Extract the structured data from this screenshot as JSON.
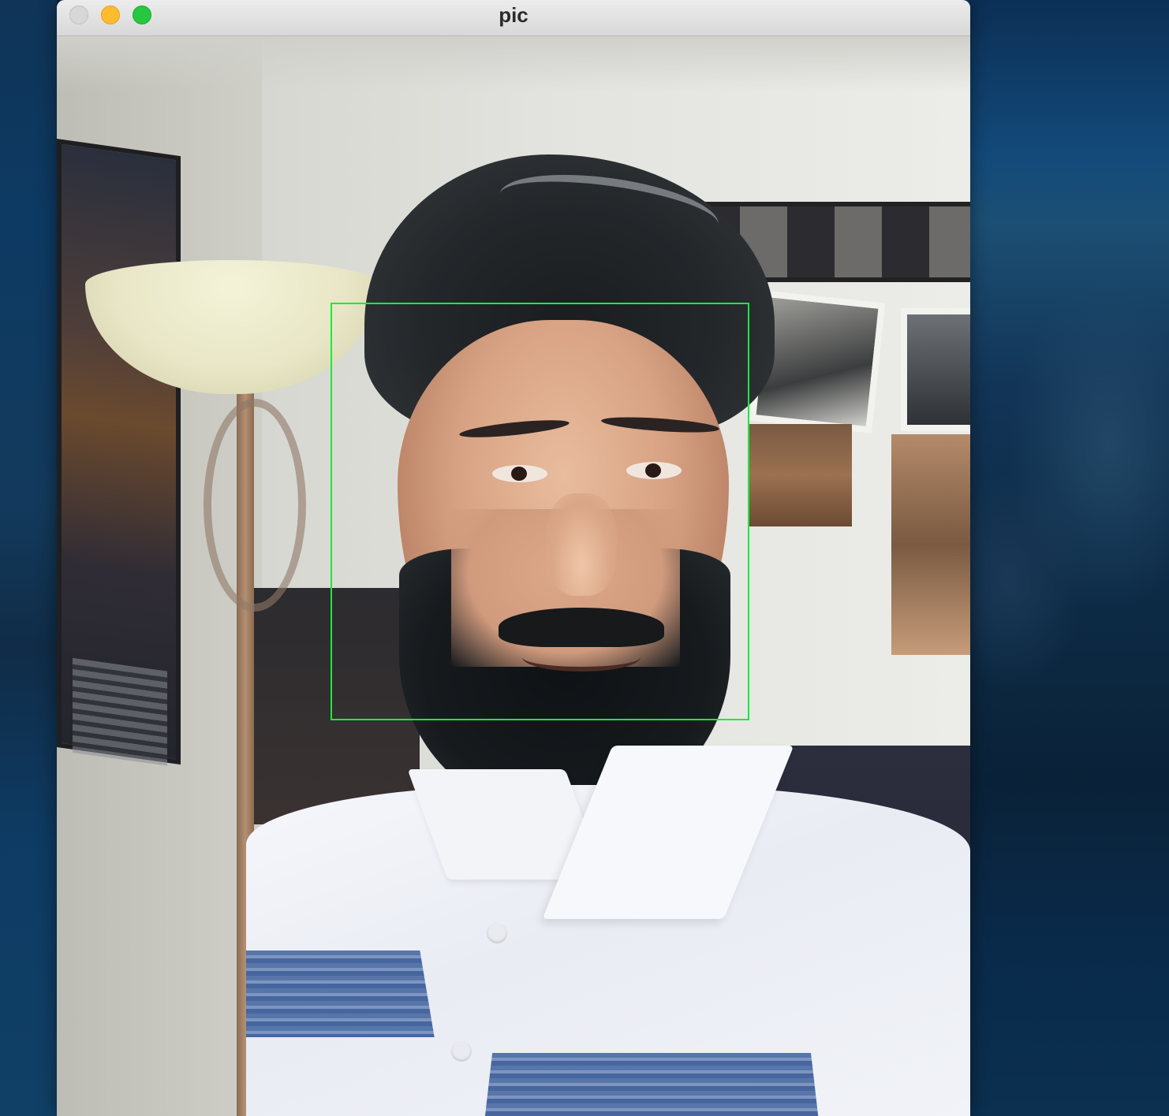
{
  "window": {
    "title": "pic",
    "traffic_lights": [
      "close-button",
      "minimize-button",
      "maximize-button"
    ]
  },
  "image_view": {
    "detection": {
      "shape": "rectangle",
      "color": "#1aeb3c"
    }
  },
  "colors": {
    "titlebar": "#e2e1e1",
    "close": "#d8d6d6",
    "minimize": "#fdbb2f",
    "maximize": "#27c83f"
  }
}
